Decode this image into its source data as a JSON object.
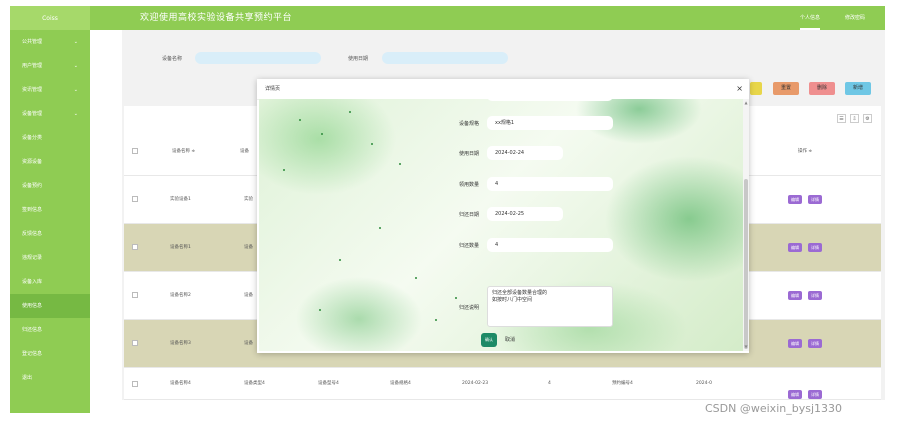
{
  "colors": {
    "accent": "#8fcc53",
    "accent_dark": "#76b943",
    "op_button": "#9b6ad3",
    "alt_row": "#d8d6b5",
    "confirm": "#1d8a66"
  },
  "header": {
    "brand": "Coiss",
    "title": "欢迎使用高校实验设备共享预约平台",
    "links": [
      "个人信息",
      "修改密码"
    ]
  },
  "sidebar": {
    "items": [
      {
        "label": "公共管理",
        "chevron": true
      },
      {
        "label": "用户管理",
        "chevron": true
      },
      {
        "label": "资讯管理",
        "chevron": true
      },
      {
        "label": "设备管理",
        "chevron": true
      },
      {
        "label": "设备分类",
        "chevron": false
      },
      {
        "label": "资源设备",
        "chevron": false
      },
      {
        "label": "设备预约",
        "chevron": false
      },
      {
        "label": "签到信息",
        "chevron": false
      },
      {
        "label": "反馈信息",
        "chevron": false
      },
      {
        "label": "违规记录",
        "chevron": false
      },
      {
        "label": "设备入库",
        "chevron": false
      },
      {
        "label": "使用信息",
        "chevron": false
      },
      {
        "label": "归还信息",
        "chevron": false
      },
      {
        "label": "登记信息",
        "chevron": false
      },
      {
        "label": "退出",
        "chevron": false
      }
    ],
    "active_index": 11
  },
  "search": {
    "device_name_label": "设备名称",
    "use_date_label": "使用日期"
  },
  "toolbar": {
    "buttons": [
      "重置",
      "删除",
      "新增"
    ]
  },
  "table": {
    "headers": [
      "设备名称 ≑",
      "设备",
      "操作 ≑"
    ],
    "rows": [
      {
        "name": "实验设备1",
        "col2": "实验",
        "ops": [
          "编辑",
          "详情"
        ]
      },
      {
        "name": "设备名称1",
        "col2": "设备",
        "ops": [
          "编辑",
          "详情"
        ]
      },
      {
        "name": "设备名称2",
        "col2": "设备",
        "ops": [
          "编辑",
          "详情"
        ]
      },
      {
        "name": "设备名称3",
        "col2": "设备",
        "ops": [
          "编辑",
          "详情"
        ]
      },
      {
        "name": "设备名称4",
        "col2": "设备类型4",
        "col3": "设备型号4",
        "col4": "设备规格4",
        "col5": "2024-02-23",
        "col6": "4",
        "col7": "预约编号4",
        "col8": "2024-0",
        "ops": [
          "编辑",
          "详情"
        ]
      }
    ],
    "tools": [
      "☰",
      "⇩",
      "⚙"
    ]
  },
  "modal": {
    "title": "详情页",
    "close": "×",
    "fields": [
      {
        "label": "设备规格",
        "value": "xx规格1"
      },
      {
        "label": "使用日期",
        "value": "2024-02-24"
      },
      {
        "label": "领用数量",
        "value": "4"
      },
      {
        "label": "归还日期",
        "value": "2024-02-25"
      },
      {
        "label": "归还数量",
        "value": "4"
      }
    ],
    "remark_label": "归还说明",
    "remark_value": "归还全部设备数量合理的\n如按时八门中空间",
    "confirm": "确认",
    "cancel": "取消"
  },
  "watermark": "CSDN @weixin_bysj1330"
}
